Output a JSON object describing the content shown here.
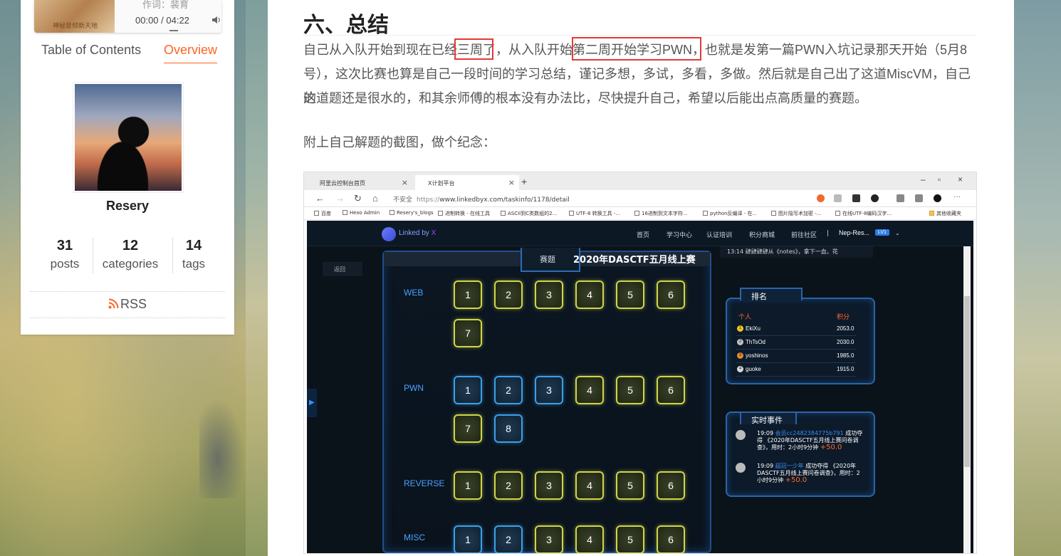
{
  "player": {
    "author": "作词：裴育",
    "time": "00:00 / 04:22",
    "cover_text": "神秘音频新天地"
  },
  "sidebar": {
    "tabs": {
      "toc": "Table of Contents",
      "overview": "Overview"
    },
    "author_name": "Resery",
    "stats": {
      "posts": {
        "count": "31",
        "label": "posts"
      },
      "categories": {
        "count": "12",
        "label": "categories"
      },
      "tags": {
        "count": "14",
        "label": "tags"
      }
    },
    "rss": "RSS"
  },
  "article": {
    "heading": "六、总结",
    "para1_line1": "自己从入队开始到现在已经三周了，从入队开始第二周开始学习PWN，也就是发第一篇PWN入坑记录那天开始（5月8",
    "para1_line2": "号），这次比赛也算是自己一段时间的学习总结，谨记多想，多试，多看，多做。然后就是自己出了这道MiscVM，自己的",
    "para1_line3": "这道题还是很水的，和其余师傅的根本没有办法比，尽快提升自己，希望以后能出点高质量的赛题。",
    "para2": "附上自己解题的截图，做个纪念："
  },
  "browser": {
    "tabs": [
      {
        "label": "阿里云控制台首页"
      },
      {
        "label": "X计划平台"
      }
    ],
    "insecure_label": "不安全",
    "url_scheme": "https://",
    "url_rest": "www.linkedbyx.com/taskinfo/1178/detail",
    "bookmarks": [
      "百度",
      "Hexo Admin",
      "Resery's_blogs",
      "进制转换 - 在线工具",
      "ASCII到C类数组的2...",
      "UTF-8 转换工具 -...",
      "16进制到文本字符...",
      "python反编译 - 在...",
      "图片隐写术加密 -...",
      "在线UTF-8编码汉字...",
      "其他收藏夹"
    ]
  },
  "site": {
    "logo_text_a": "Linked by ",
    "logo_text_b": "X",
    "nav": [
      "首页",
      "学习中心",
      "认证培训",
      "积分商城",
      "前往社区"
    ],
    "nav_sep": "|",
    "user": "Nep-Res...",
    "level": "LV1",
    "back": "返回",
    "board_label": "赛题",
    "board_title": "2020年DASCTF五月线上赛",
    "feed_top": "13:14  肆肆肆肆从《notes》，拿下一血，花",
    "categories": [
      {
        "name": "WEB",
        "tasks": [
          {
            "n": "1",
            "s": true
          },
          {
            "n": "2",
            "s": true
          },
          {
            "n": "3",
            "s": true
          },
          {
            "n": "4",
            "s": true
          },
          {
            "n": "5",
            "s": true
          },
          {
            "n": "6",
            "s": true
          },
          {
            "n": "7",
            "s": true
          }
        ]
      },
      {
        "name": "PWN",
        "tasks": [
          {
            "n": "1",
            "s": false
          },
          {
            "n": "2",
            "s": false
          },
          {
            "n": "3",
            "s": false
          },
          {
            "n": "4",
            "s": true
          },
          {
            "n": "5",
            "s": true
          },
          {
            "n": "6",
            "s": true
          },
          {
            "n": "7",
            "s": true
          },
          {
            "n": "8",
            "s": false
          }
        ]
      },
      {
        "name": "REVERSE",
        "tasks": [
          {
            "n": "1",
            "s": true
          },
          {
            "n": "2",
            "s": true
          },
          {
            "n": "3",
            "s": true
          },
          {
            "n": "4",
            "s": true
          },
          {
            "n": "5",
            "s": true
          },
          {
            "n": "6",
            "s": true
          }
        ]
      },
      {
        "name": "MISC",
        "tasks": [
          {
            "n": "1",
            "s": false
          },
          {
            "n": "2",
            "s": false
          },
          {
            "n": "3",
            "s": true
          },
          {
            "n": "4",
            "s": true
          },
          {
            "n": "5",
            "s": true
          },
          {
            "n": "6",
            "s": true
          }
        ]
      }
    ],
    "ranking": {
      "title": "排名",
      "col_person": "个人",
      "col_score": "积分",
      "rows": [
        {
          "rank": "1",
          "name": "EkiXu",
          "score": "2053.0",
          "color": "#f5c518"
        },
        {
          "rank": "2",
          "name": "ThTsOd",
          "score": "2030.0",
          "color": "#c0c0c0"
        },
        {
          "rank": "3",
          "name": "yoshinos",
          "score": "1985.0",
          "color": "#e38a2c"
        },
        {
          "rank": "4",
          "name": "guoke",
          "score": "1915.0",
          "color": "#d8d8d8"
        }
      ]
    },
    "events": {
      "title": "实时事件",
      "items": [
        {
          "time": "19:09",
          "user": "会员cc2482384775b791",
          "text": "成功夺得 《2020年DASCTF五月线上赛问卷调查》，用时：2小时9分钟",
          "score": "+50.0"
        },
        {
          "time": "19:09",
          "user": "超冠一少年",
          "text": "成功夺得 《2020年DASCTF五月线上赛问卷调查》，用时：2小时9分钟",
          "score": "+50.0"
        }
      ]
    }
  },
  "colors": {
    "accent": "#fc6423",
    "highlight": "#e53935"
  }
}
